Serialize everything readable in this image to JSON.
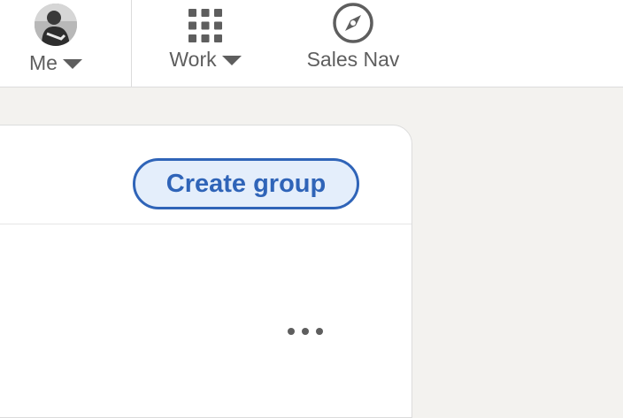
{
  "nav": {
    "me": {
      "label": "Me"
    },
    "work": {
      "label": "Work"
    },
    "sales_nav": {
      "label": "Sales Nav"
    }
  },
  "groups_card": {
    "create_button_label": "Create group"
  },
  "colors": {
    "brand_blue": "#2f64b8",
    "button_fill": "#e4eefb",
    "nav_text": "#5e5e5e",
    "page_bg": "#f3f2ef"
  },
  "icons": [
    "avatar",
    "caret-down-icon",
    "grid-icon",
    "compass-icon",
    "more-icon"
  ]
}
